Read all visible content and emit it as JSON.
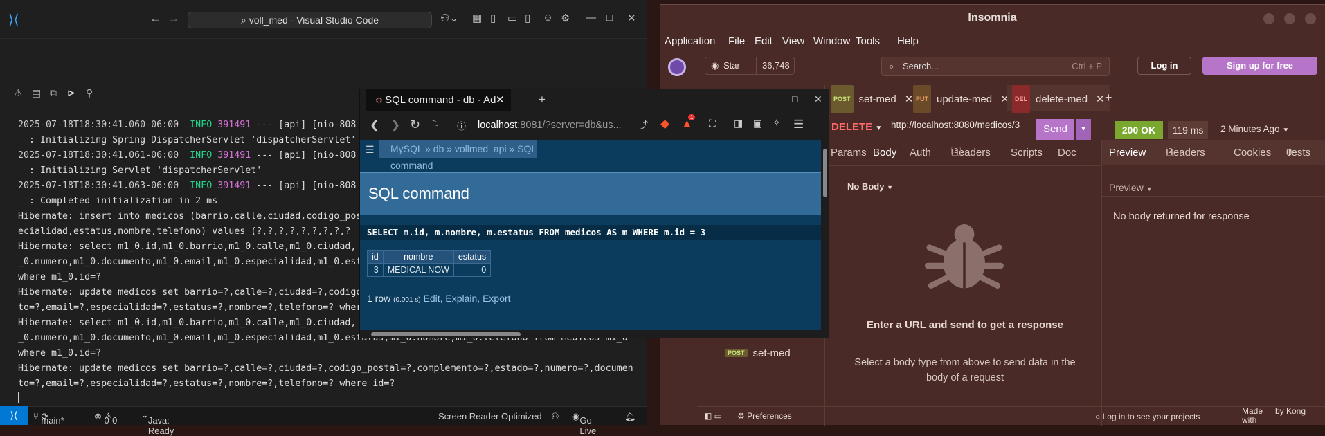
{
  "vscode": {
    "title": "voll_med - Visual Studio Code",
    "terminal_lines": [
      {
        "ts": "2025-07-18T18:30:41.060-06:00",
        "lvl": "INFO",
        "pid": "391491",
        "rest": "--- [api] [nio-808"
      },
      {
        "text": "  : Initializing Spring DispatcherServlet 'dispatcherServlet'"
      },
      {
        "ts": "2025-07-18T18:30:41.061-06:00",
        "lvl": "INFO",
        "pid": "391491",
        "rest": "--- [api] [nio-808"
      },
      {
        "text": "  : Initializing Servlet 'dispatcherServlet'"
      },
      {
        "ts": "2025-07-18T18:30:41.063-06:00",
        "lvl": "INFO",
        "pid": "391491",
        "rest": "--- [api] [nio-808"
      },
      {
        "text": "  : Completed initialization in 2 ms"
      },
      {
        "text": "Hibernate: insert into medicos (barrio,calle,ciudad,codigo_pos"
      },
      {
        "text": "ecialidad,estatus,nombre,telefono) values (?,?,?,?,?,?,?,?,?"
      },
      {
        "text": "Hibernate: select m1_0.id,m1_0.barrio,m1_0.calle,m1_0.ciudad,"
      },
      {
        "text": "_0.numero,m1_0.documento,m1_0.email,m1_0.especialidad,m1_0.est"
      },
      {
        "text": "where m1_0.id=?"
      },
      {
        "text": "Hibernate: update medicos set barrio=?,calle=?,ciudad=?,codigo"
      },
      {
        "text": "to=?,email=?,especialidad=?,estatus=?,nombre=?,telefono=? wher"
      },
      {
        "text": "Hibernate: select m1_0.id,m1_0.barrio,m1_0.calle,m1_0.ciudad,"
      },
      {
        "text": "_0.numero,m1_0.documento,m1_0.email,m1_0.especialidad,m1_0.estatus,m1_0.nombre,m1_0.telefono from medicos m1_0"
      },
      {
        "text": "where m1_0.id=?"
      },
      {
        "text": "Hibernate: update medicos set barrio=?,calle=?,ciudad=?,codigo_postal=?,complemento=?,estado=?,numero=?,documen"
      },
      {
        "text": "to=?,email=?,especialidad=?,estatus=?,nombre=?,telefono=? where id=?"
      }
    ],
    "status": {
      "branch": "main*",
      "errors": "0",
      "warnings": "0",
      "java": "Java: Ready",
      "screen_reader": "Screen Reader Optimized",
      "go_live": "Go Live"
    }
  },
  "brave": {
    "tab_title": "SQL command - db - Ad",
    "url_host": "localhost",
    "url_rest": ":8081/?server=db&us...",
    "breadcrumb": "MySQL » db » vollmed_api » SQL command",
    "heading": "SQL command",
    "query": "SELECT m.id, m.nombre, m.estatus FROM medicos AS m WHERE m.id = 3",
    "result_headers": [
      "id",
      "nombre",
      "estatus"
    ],
    "result_rows": [
      [
        "3",
        "MEDICAL NOW",
        "0"
      ]
    ],
    "row_count": "1 row",
    "row_time": "(0.001 s)",
    "row_links": "Edit, Explain, Export",
    "badge_count": "1"
  },
  "insomnia": {
    "title": "Insomnia",
    "menu": [
      "Application",
      "File",
      "Edit",
      "View",
      "Window",
      "Tools",
      "Help"
    ],
    "star_label": "Star",
    "star_count": "36,748",
    "search_placeholder": "Search...",
    "search_shortcut": "Ctrl + P",
    "login": "Log in",
    "signup": "Sign up for free",
    "tabs": [
      {
        "method": "POST",
        "name": "set-med"
      },
      {
        "method": "PUT",
        "name": "update-med"
      },
      {
        "method": "DEL",
        "name": "delete-med"
      }
    ],
    "request": {
      "method": "DELETE",
      "url": "http://localhost:8080/medicos/3",
      "send": "Send",
      "tabs": [
        "Params",
        "Body",
        "Auth",
        "Headers",
        "Scripts",
        "Doc"
      ],
      "headers_count": "3",
      "body_type": "No Body",
      "empty_title": "Enter a URL and send to get a response",
      "empty_desc": "Select a body type from above to send data in the body of a request"
    },
    "response": {
      "status": "200 OK",
      "time": "119 ms",
      "ago": "2 Minutes Ago",
      "tabs": [
        "Preview",
        "Headers",
        "Cookies",
        "Tests"
      ],
      "headers_count": "2",
      "tests_count": "0",
      "preview_mode": "Preview",
      "message": "No body returned for response"
    },
    "sidebar_item": {
      "method": "POST",
      "name": "set-med"
    },
    "preferences": "Preferences",
    "login_projects": "Log in to see your projects",
    "made_with": "Made with",
    "by_kong": "by Kong"
  }
}
